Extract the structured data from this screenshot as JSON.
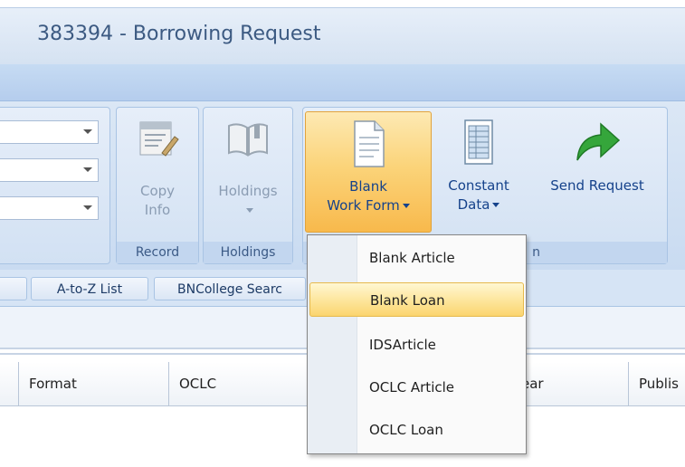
{
  "window": {
    "title": "383394 - Borrowing Request"
  },
  "ribbon": {
    "groups": {
      "record": {
        "label": "Record",
        "copy_info": [
          "Copy",
          "Info"
        ]
      },
      "holdings": {
        "label": "Holdings",
        "button": "Holdings"
      },
      "request_group_label_fragment": "n"
    },
    "blank_work_form": [
      "Blank",
      "Work Form"
    ],
    "constant_data": [
      "Constant",
      "Data"
    ],
    "send_request": "Send Request"
  },
  "tabs": [
    "A-to-Z List",
    "BNCollege Searc"
  ],
  "grid": {
    "columns": [
      "Format",
      "OCLC",
      "ear",
      "Publis"
    ]
  },
  "dropdown_menu": {
    "items": [
      "Blank Article",
      "Blank Loan",
      "IDSArticle",
      "OCLC Article",
      "OCLC Loan"
    ],
    "highlighted_index": 1
  },
  "colors": {
    "active_button": "#f8b94c",
    "ribbon": "#d2e1f3",
    "send_arrow": "#2f9e36"
  }
}
